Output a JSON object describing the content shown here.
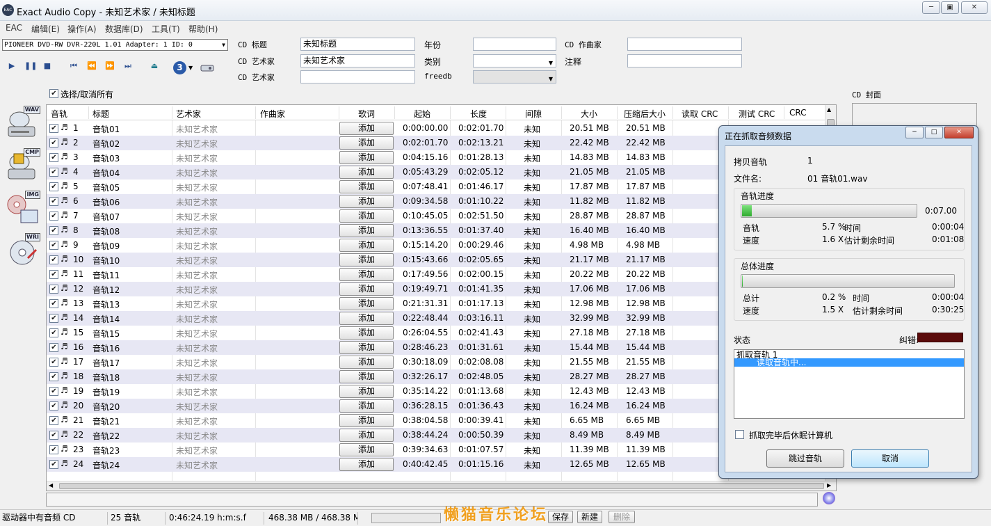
{
  "window": {
    "title": "Exact Audio Copy   -   未知艺术家 / 未知标题",
    "icon_text": "EAC"
  },
  "menu": [
    "EAC",
    "编辑(E)",
    "操作(A)",
    "数据库(D)",
    "工具(T)",
    "帮助(H)"
  ],
  "drive": {
    "selected": "PIONEER DVD-RW  DVR-220L 1.01   Adapter: 1  ID: 0"
  },
  "toolbar": {
    "badge": "3"
  },
  "cd_info": {
    "title_label": "CD 标题",
    "title_value": "未知标题",
    "artist_label": "CD 艺术家",
    "artist_value": "未知艺术家",
    "artist2_label": "CD 艺术家",
    "artist2_value": "",
    "year_label": "年份",
    "year_value": "",
    "genre_label": "类别",
    "genre_value": "",
    "freedb_label": "freedb",
    "freedb_value": "",
    "composer_label": "CD 作曲家",
    "composer_value": "",
    "comment_label": "注释",
    "comment_value": ""
  },
  "select_all_label": "选择/取消所有",
  "side_tags": [
    "WAV",
    "CMP",
    "IMG",
    "WRI"
  ],
  "columns": {
    "track": "音轨",
    "title": "标题",
    "artist": "艺术家",
    "composer": "作曲家",
    "lyrics": "歌词",
    "start": "起始",
    "length": "长度",
    "gap": "间隙",
    "size": "大小",
    "csize": "压缩后大小",
    "read_crc": "读取 CRC",
    "test_crc": "测试 CRC",
    "crc": "CRC"
  },
  "tracks": [
    {
      "num": "1",
      "title": "音轨01",
      "artist": "未知艺术家",
      "lyrics": "添加",
      "start": "0:00:00.00",
      "length": "0:02:01.70",
      "gap": "未知",
      "size": "20.51 MB",
      "csize": "20.51 MB"
    },
    {
      "num": "2",
      "title": "音轨02",
      "artist": "未知艺术家",
      "lyrics": "添加",
      "start": "0:02:01.70",
      "length": "0:02:13.21",
      "gap": "未知",
      "size": "22.42 MB",
      "csize": "22.42 MB"
    },
    {
      "num": "3",
      "title": "音轨03",
      "artist": "未知艺术家",
      "lyrics": "添加",
      "start": "0:04:15.16",
      "length": "0:01:28.13",
      "gap": "未知",
      "size": "14.83 MB",
      "csize": "14.83 MB"
    },
    {
      "num": "4",
      "title": "音轨04",
      "artist": "未知艺术家",
      "lyrics": "添加",
      "start": "0:05:43.29",
      "length": "0:02:05.12",
      "gap": "未知",
      "size": "21.05 MB",
      "csize": "21.05 MB"
    },
    {
      "num": "5",
      "title": "音轨05",
      "artist": "未知艺术家",
      "lyrics": "添加",
      "start": "0:07:48.41",
      "length": "0:01:46.17",
      "gap": "未知",
      "size": "17.87 MB",
      "csize": "17.87 MB"
    },
    {
      "num": "6",
      "title": "音轨06",
      "artist": "未知艺术家",
      "lyrics": "添加",
      "start": "0:09:34.58",
      "length": "0:01:10.22",
      "gap": "未知",
      "size": "11.82 MB",
      "csize": "11.82 MB"
    },
    {
      "num": "7",
      "title": "音轨07",
      "artist": "未知艺术家",
      "lyrics": "添加",
      "start": "0:10:45.05",
      "length": "0:02:51.50",
      "gap": "未知",
      "size": "28.87 MB",
      "csize": "28.87 MB"
    },
    {
      "num": "8",
      "title": "音轨08",
      "artist": "未知艺术家",
      "lyrics": "添加",
      "start": "0:13:36.55",
      "length": "0:01:37.40",
      "gap": "未知",
      "size": "16.40 MB",
      "csize": "16.40 MB"
    },
    {
      "num": "9",
      "title": "音轨09",
      "artist": "未知艺术家",
      "lyrics": "添加",
      "start": "0:15:14.20",
      "length": "0:00:29.46",
      "gap": "未知",
      "size": "4.98 MB",
      "csize": "4.98 MB"
    },
    {
      "num": "10",
      "title": "音轨10",
      "artist": "未知艺术家",
      "lyrics": "添加",
      "start": "0:15:43.66",
      "length": "0:02:05.65",
      "gap": "未知",
      "size": "21.17 MB",
      "csize": "21.17 MB"
    },
    {
      "num": "11",
      "title": "音轨11",
      "artist": "未知艺术家",
      "lyrics": "添加",
      "start": "0:17:49.56",
      "length": "0:02:00.15",
      "gap": "未知",
      "size": "20.22 MB",
      "csize": "20.22 MB"
    },
    {
      "num": "12",
      "title": "音轨12",
      "artist": "未知艺术家",
      "lyrics": "添加",
      "start": "0:19:49.71",
      "length": "0:01:41.35",
      "gap": "未知",
      "size": "17.06 MB",
      "csize": "17.06 MB"
    },
    {
      "num": "13",
      "title": "音轨13",
      "artist": "未知艺术家",
      "lyrics": "添加",
      "start": "0:21:31.31",
      "length": "0:01:17.13",
      "gap": "未知",
      "size": "12.98 MB",
      "csize": "12.98 MB"
    },
    {
      "num": "14",
      "title": "音轨14",
      "artist": "未知艺术家",
      "lyrics": "添加",
      "start": "0:22:48.44",
      "length": "0:03:16.11",
      "gap": "未知",
      "size": "32.99 MB",
      "csize": "32.99 MB"
    },
    {
      "num": "15",
      "title": "音轨15",
      "artist": "未知艺术家",
      "lyrics": "添加",
      "start": "0:26:04.55",
      "length": "0:02:41.43",
      "gap": "未知",
      "size": "27.18 MB",
      "csize": "27.18 MB"
    },
    {
      "num": "16",
      "title": "音轨16",
      "artist": "未知艺术家",
      "lyrics": "添加",
      "start": "0:28:46.23",
      "length": "0:01:31.61",
      "gap": "未知",
      "size": "15.44 MB",
      "csize": "15.44 MB"
    },
    {
      "num": "17",
      "title": "音轨17",
      "artist": "未知艺术家",
      "lyrics": "添加",
      "start": "0:30:18.09",
      "length": "0:02:08.08",
      "gap": "未知",
      "size": "21.55 MB",
      "csize": "21.55 MB"
    },
    {
      "num": "18",
      "title": "音轨18",
      "artist": "未知艺术家",
      "lyrics": "添加",
      "start": "0:32:26.17",
      "length": "0:02:48.05",
      "gap": "未知",
      "size": "28.27 MB",
      "csize": "28.27 MB"
    },
    {
      "num": "19",
      "title": "音轨19",
      "artist": "未知艺术家",
      "lyrics": "添加",
      "start": "0:35:14.22",
      "length": "0:01:13.68",
      "gap": "未知",
      "size": "12.43 MB",
      "csize": "12.43 MB"
    },
    {
      "num": "20",
      "title": "音轨20",
      "artist": "未知艺术家",
      "lyrics": "添加",
      "start": "0:36:28.15",
      "length": "0:01:36.43",
      "gap": "未知",
      "size": "16.24 MB",
      "csize": "16.24 MB"
    },
    {
      "num": "21",
      "title": "音轨21",
      "artist": "未知艺术家",
      "lyrics": "添加",
      "start": "0:38:04.58",
      "length": "0:00:39.41",
      "gap": "未知",
      "size": "6.65 MB",
      "csize": "6.65 MB"
    },
    {
      "num": "22",
      "title": "音轨22",
      "artist": "未知艺术家",
      "lyrics": "添加",
      "start": "0:38:44.24",
      "length": "0:00:50.39",
      "gap": "未知",
      "size": "8.49 MB",
      "csize": "8.49 MB"
    },
    {
      "num": "23",
      "title": "音轨23",
      "artist": "未知艺术家",
      "lyrics": "添加",
      "start": "0:39:34.63",
      "length": "0:01:07.57",
      "gap": "未知",
      "size": "11.39 MB",
      "csize": "11.39 MB"
    },
    {
      "num": "24",
      "title": "音轨24",
      "artist": "未知艺术家",
      "lyrics": "添加",
      "start": "0:40:42.45",
      "length": "0:01:15.16",
      "gap": "未知",
      "size": "12.65 MB",
      "csize": "12.65 MB"
    }
  ],
  "cover_label": "CD 封面",
  "status_bar": {
    "drive_msg": "驱动器中有音频 CD",
    "track_count": "25 音轨",
    "duration": "0:46:24.19 h:m:s.f",
    "size": "468.38 MB / 468.38 M",
    "save": "保存",
    "new": "新建",
    "delete": "删除"
  },
  "watermark": "懒猫音乐论坛",
  "dialog": {
    "title": "正在抓取音频数据",
    "copy_track_label": "拷贝音轨",
    "copy_track_value": "1",
    "filename_label": "文件名:",
    "filename_value": "01 音轨01.wav",
    "track_progress": {
      "header": "音轨进度",
      "fill": 0.057,
      "time_right": "0:07.00",
      "track_label": "音轨",
      "track_pct": "5.7 %",
      "time_label": "时间",
      "time_value": "0:00:04",
      "speed_label": "速度",
      "speed_value": "1.6 X",
      "remain_label": "估计剩余时间",
      "remain_value": "0:01:08"
    },
    "total_progress": {
      "header": "总体进度",
      "fill": 0.002,
      "total_label": "总计",
      "total_pct": "0.2 %",
      "time_label": "时间",
      "time_value": "0:00:04",
      "speed_label": "速度",
      "speed_value": "1.5 X",
      "remain_label": "估计剩余时间",
      "remain_value": "0:30:25"
    },
    "status_label": "状态",
    "error_label": "纠错:",
    "status_lines": [
      "抓取音轨  1",
      "读取音轨中..."
    ],
    "hibernate_label": "抓取完毕后休眠计算机",
    "skip_button": "跳过音轨",
    "cancel_button": "取消"
  },
  "colors": {
    "selection": "#3399ff",
    "alt_row": "#e7e7f4",
    "progress_green": "#2faa2f",
    "error_bg": "#5a0a0a"
  }
}
